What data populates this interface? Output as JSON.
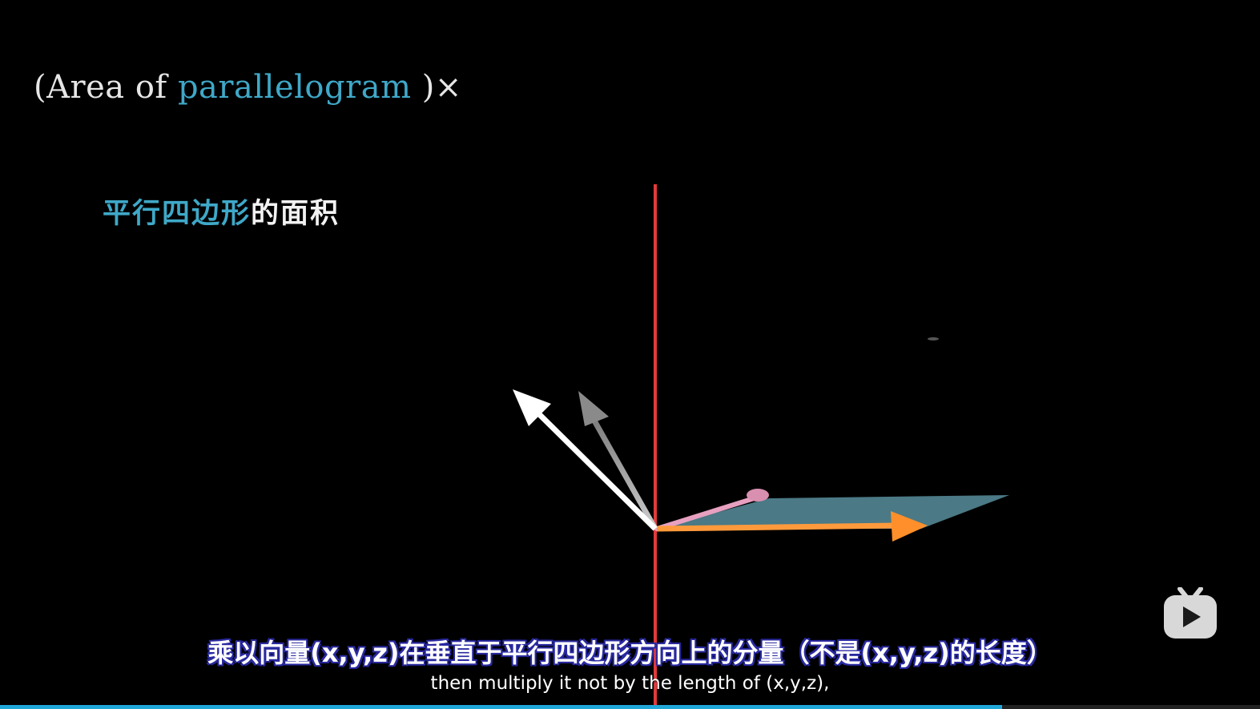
{
  "formula": {
    "open_paren": "(",
    "prefix": "Area of ",
    "accent_word": "parallelogram",
    "close_paren": " )",
    "operator": "×"
  },
  "cn_label": {
    "accent": "平行四边形",
    "rest": "的面积"
  },
  "subtitles": {
    "chinese": "乘以向量(x,y,z)在垂直于平行四边形方向上的分量（不是(x,y,z)的长度）",
    "english": "then multiply it not by the length of (x,y,z),"
  },
  "watermark": {
    "icon": "bilibili-tv-icon"
  },
  "progress": {
    "fraction": 0.795
  },
  "colors": {
    "accent_text": "#3fa8c8",
    "axis": "#e23b3b",
    "plane": "#4f7f8c",
    "vector_orange": "#ff9a3c",
    "vector_pink": "#e8a0c0",
    "vector_white": "#ffffff",
    "progress": "#1fa7d8"
  }
}
